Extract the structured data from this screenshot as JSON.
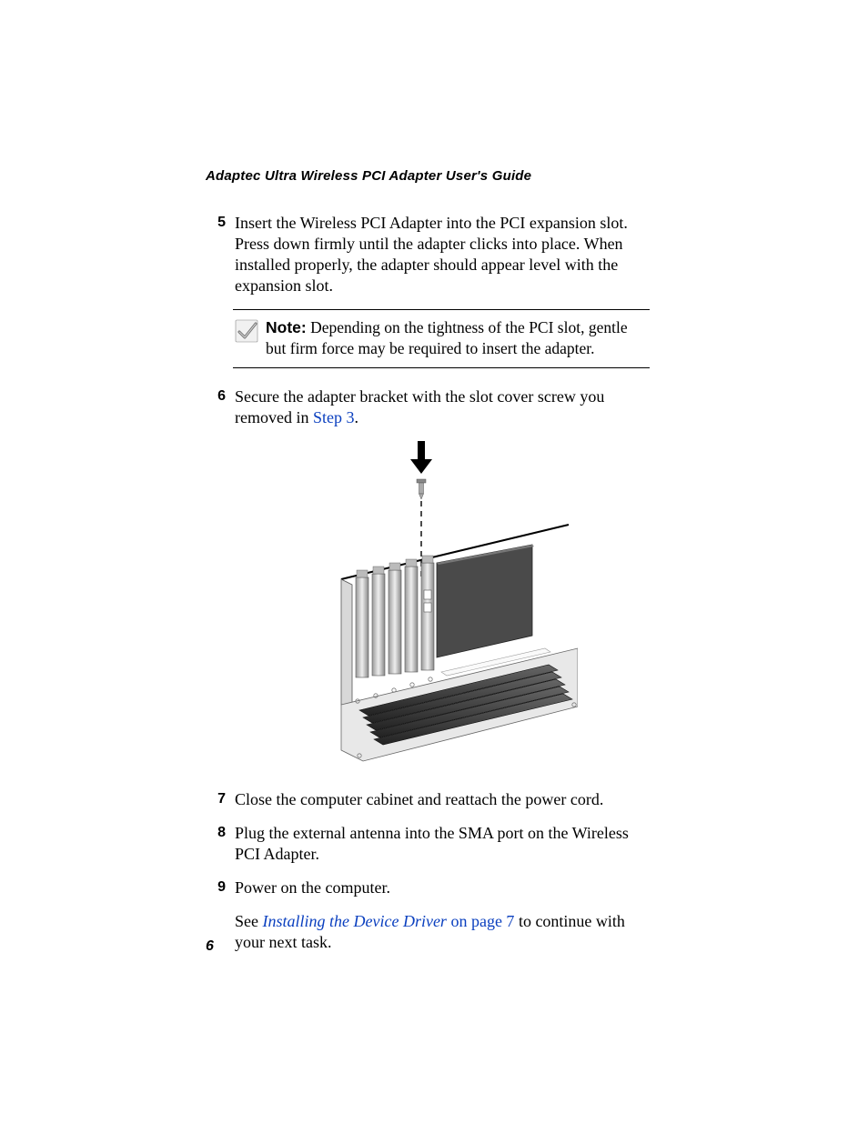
{
  "header": {
    "running_title": "Adaptec Ultra Wireless PCI Adapter User's Guide"
  },
  "steps": [
    {
      "num": "5",
      "body": "Insert the Wireless PCI Adapter into the PCI expansion slot. Press down firmly until the adapter clicks into place. When installed properly, the adapter should appear level with the expansion slot."
    },
    {
      "num": "6",
      "body_prefix": "Secure the adapter bracket with the slot cover screw you removed in ",
      "link": "Step 3",
      "body_suffix": "."
    },
    {
      "num": "7",
      "body": "Close the computer cabinet and reattach the power cord."
    },
    {
      "num": "8",
      "body": "Plug the external antenna into the SMA port on the Wireless PCI Adapter."
    },
    {
      "num": "9",
      "body": "Power on the computer."
    }
  ],
  "note": {
    "label": "Note:",
    "body": " Depending on the tightness of the PCI slot, gentle but firm force may be required to insert the adapter."
  },
  "continuation": {
    "prefix": "See ",
    "link_italic": "Installing the Device Driver",
    "link_rest": " on page 7",
    "suffix": " to continue with your next task."
  },
  "page_number": "6",
  "figure": {
    "alt": "pci-bracket-screw-illustration"
  }
}
